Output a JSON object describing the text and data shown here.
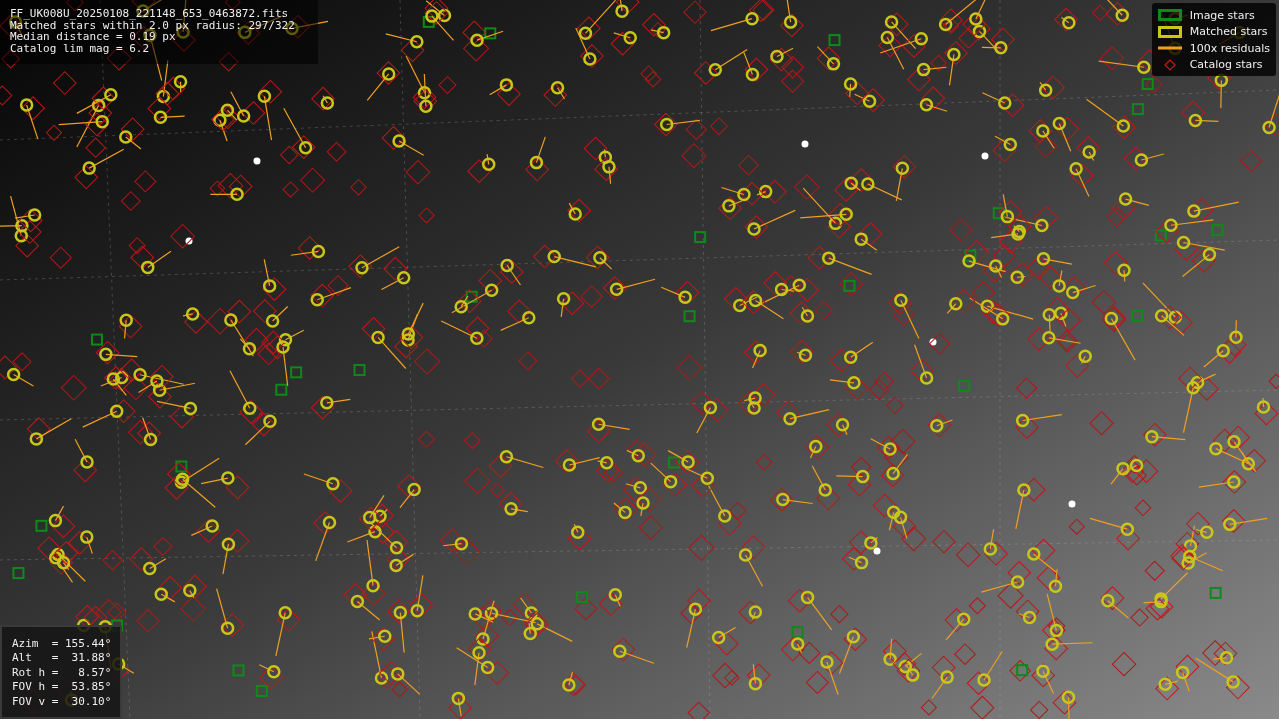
{
  "info": {
    "lines": [
      "FF_UK008U_20250108_221148_653_0463872.fits",
      "Matched stars within 2.0 px radius: 297/322",
      "Median distance = 0.19 px",
      "Catalog lim mag = 6.2"
    ]
  },
  "legend": [
    {
      "label": "Image stars",
      "kind": "box",
      "color": "#0f8a1a"
    },
    {
      "label": "Matched stars",
      "kind": "box",
      "color": "#c8c81a"
    },
    {
      "label": "100x residuals",
      "kind": "line",
      "color": "#f0a020"
    },
    {
      "label": "Catalog stars",
      "kind": "diamond",
      "color": "#d01818"
    }
  ],
  "pointing": {
    "lines": [
      "Azim  = 155.44°",
      "Alt   =  31.88°",
      "Rot h =   8.57°",
      "FOV h =  53.85°",
      "FOV v =  30.10°"
    ]
  }
}
